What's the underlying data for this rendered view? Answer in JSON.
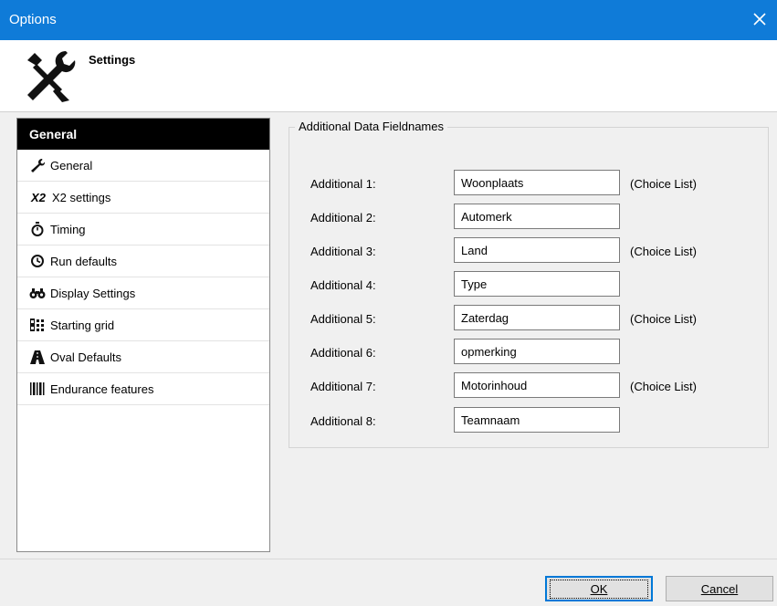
{
  "window": {
    "title": "Options"
  },
  "header": {
    "title": "Settings",
    "icon": "tools-icon"
  },
  "sidebar": {
    "header": "General",
    "items": [
      {
        "label": "General",
        "icon": "wrench-icon"
      },
      {
        "label": "X2 settings",
        "icon": "x2-icon",
        "icon_text": "X2"
      },
      {
        "label": "Timing",
        "icon": "stopwatch-icon"
      },
      {
        "label": "Run defaults",
        "icon": "clock-icon"
      },
      {
        "label": "Display Settings",
        "icon": "binoculars-icon"
      },
      {
        "label": "Starting grid",
        "icon": "starting-grid-icon"
      },
      {
        "label": "Oval Defaults",
        "icon": "oval-track-icon"
      },
      {
        "label": "Endurance features",
        "icon": "barcode-icon"
      }
    ]
  },
  "main": {
    "group_title": "Additional Data Fieldnames",
    "fields": [
      {
        "label": "Additional 1:",
        "value": "Woonplaats",
        "choice": "(Choice List)"
      },
      {
        "label": "Additional 2:",
        "value": "Automerk",
        "choice": ""
      },
      {
        "label": "Additional 3:",
        "value": "Land",
        "choice": "(Choice List)"
      },
      {
        "label": "Additional 4:",
        "value": "Type",
        "choice": ""
      },
      {
        "label": "Additional 5:",
        "value": "Zaterdag",
        "choice": "(Choice List)"
      },
      {
        "label": "Additional 6:",
        "value": "opmerking",
        "choice": ""
      },
      {
        "label": "Additional 7:",
        "value": "Motorinhoud",
        "choice": "(Choice List)"
      },
      {
        "label": "Additional 8:",
        "value": "Teamnaam",
        "choice": ""
      }
    ]
  },
  "footer": {
    "ok_label": "OK",
    "cancel_label": "Cancel"
  },
  "colors": {
    "titlebar": "#0f7bd8",
    "sidebar_header": "#000000",
    "focus": "#0078d7"
  }
}
